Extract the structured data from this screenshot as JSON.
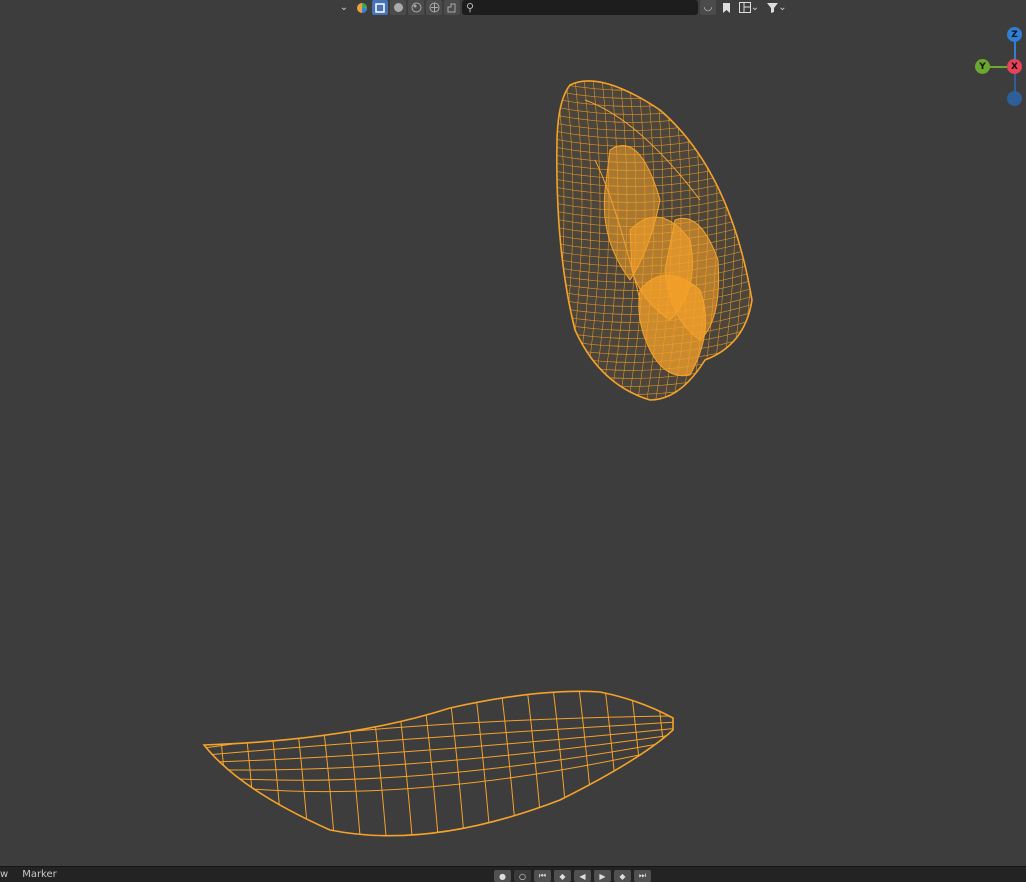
{
  "viewport": {
    "background": "#3d3d3d",
    "wire_color": "#f5a22a"
  },
  "header": {
    "dropdown_icon": "chevron-down-icon",
    "color_icon": "color-wheel-icon",
    "shading_modes": [
      "wireframe",
      "solid",
      "material",
      "rendered"
    ],
    "active_mode": "wireframe",
    "search_placeholder": "",
    "search_icon": "search-icon",
    "overlay_icon": "overlay-icon",
    "bookmark_icon": "bookmark-icon",
    "layout_icon": "layout-icon",
    "filter_icon": "filter-icon"
  },
  "gizmo": {
    "z_label": "Z",
    "y_label": "Y",
    "x_label": "X",
    "colors": {
      "z": "#2f7fd6",
      "y": "#6ba630",
      "x": "#e8415a",
      "neg_z": "#2f5f99"
    }
  },
  "timeline": {
    "view_label": "w",
    "marker_label": "Marker",
    "controls": [
      "dot",
      "jump-start",
      "prev-key",
      "play-reverse",
      "play",
      "next-key",
      "jump-end"
    ]
  }
}
